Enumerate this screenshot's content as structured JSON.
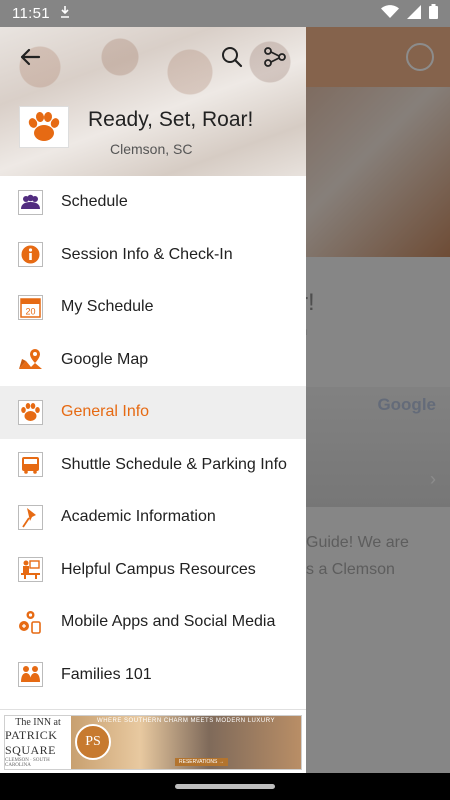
{
  "status_bar": {
    "time": "11:51"
  },
  "drawer": {
    "title": "Ready, Set, Roar!",
    "location": "Clemson, SC",
    "menu": [
      {
        "label": "Schedule",
        "icon": "people-group-icon"
      },
      {
        "label": "Session Info & Check-In",
        "icon": "info-icon"
      },
      {
        "label": "My Schedule",
        "icon": "calendar-20-icon"
      },
      {
        "label": "Google Map",
        "icon": "map-pin-icon"
      },
      {
        "label": "General Info",
        "icon": "paw-icon",
        "active": true
      },
      {
        "label": "Shuttle Schedule & Parking Info",
        "icon": "bus-icon"
      },
      {
        "label": "Academic Information",
        "icon": "pushpin-icon"
      },
      {
        "label": "Helpful Campus Resources",
        "icon": "presenter-icon"
      },
      {
        "label": "Mobile Apps and Social Media",
        "icon": "social-apps-icon"
      },
      {
        "label": "Families 101",
        "icon": "family-icon"
      }
    ],
    "ad": {
      "left_line1": "The INN at",
      "left_line2": "PATRICK SQUARE",
      "left_line3": "CLEMSON · SOUTH CAROLINA",
      "tagline": "WHERE SOUTHERN CHARM MEETS MODERN LUXURY",
      "monogram": "PS",
      "cta": "RESERVATIONS →"
    }
  },
  "background": {
    "title_fragment": "r!",
    "sub_fragment": "n",
    "map_brand": "Google",
    "text_line1": "Guide! We are",
    "text_line2": "s a Clemson"
  },
  "colors": {
    "accent": "#E66A13",
    "purple": "#522D80"
  }
}
